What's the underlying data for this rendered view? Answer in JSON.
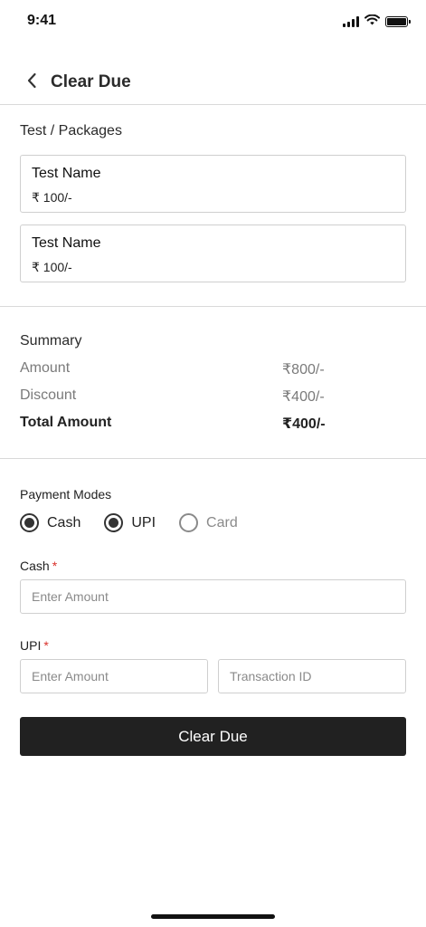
{
  "status_bar": {
    "time": "9:41"
  },
  "header": {
    "title": "Clear Due"
  },
  "tests": {
    "section_title": "Test / Packages",
    "items": [
      {
        "name": "Test Name",
        "price": "₹ 100/-"
      },
      {
        "name": "Test Name",
        "price": "₹ 100/-"
      }
    ]
  },
  "summary": {
    "title": "Summary",
    "rows": [
      {
        "label": "Amount",
        "value": "₹800/-"
      },
      {
        "label": "Discount",
        "value": "₹400/-"
      },
      {
        "label": "Total Amount",
        "value": "₹400/-"
      }
    ]
  },
  "payment": {
    "title": "Payment Modes",
    "modes": [
      {
        "label": "Cash",
        "selected": true
      },
      {
        "label": "UPI",
        "selected": true
      },
      {
        "label": "Card",
        "selected": false
      }
    ]
  },
  "cash_field": {
    "label": "Cash",
    "required_mark": "*",
    "placeholder": "Enter Amount"
  },
  "upi_field": {
    "label": "UPI",
    "required_mark": "*",
    "amount_placeholder": "Enter Amount",
    "txn_placeholder": "Transaction ID"
  },
  "actions": {
    "clear_due_label": "Clear Due"
  },
  "colors": {
    "primary_button": "#212121",
    "required": "#d9312b",
    "divider": "#d9d9d9"
  },
  "icons": {
    "back": "chevron-left-icon",
    "signal": "signal-icon",
    "wifi": "wifi-icon",
    "battery": "battery-icon"
  }
}
